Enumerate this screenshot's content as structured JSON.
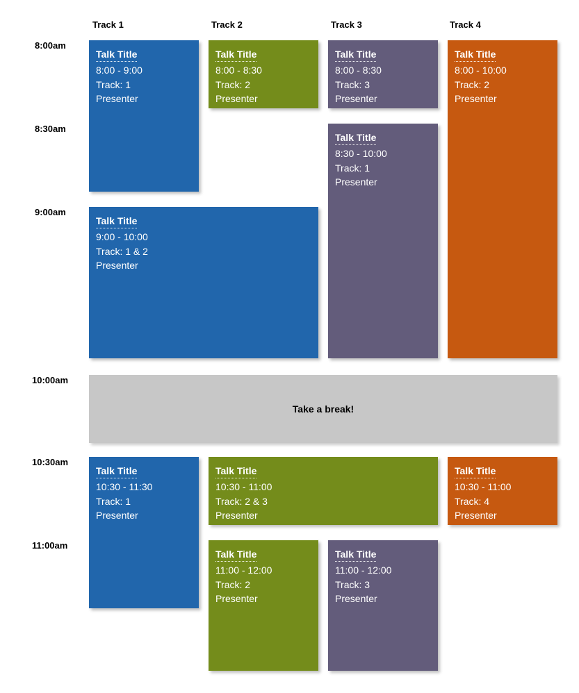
{
  "tracks": [
    {
      "label": "Track 1"
    },
    {
      "label": "Track 2"
    },
    {
      "label": "Track 3"
    },
    {
      "label": "Track 4"
    }
  ],
  "times": [
    {
      "label": "8:00am"
    },
    {
      "label": "8:30am"
    },
    {
      "label": "9:00am"
    },
    {
      "label": "10:00am"
    },
    {
      "label": "10:30am"
    },
    {
      "label": "11:00am"
    }
  ],
  "sessions": [
    {
      "title": "Talk Title",
      "time": "8:00 - 9:00",
      "track": "Track: 1",
      "presenter": "Presenter"
    },
    {
      "title": "Talk Title",
      "time": "8:00 - 8:30",
      "track": "Track: 2",
      "presenter": "Presenter"
    },
    {
      "title": "Talk Title",
      "time": "8:00 - 8:30",
      "track": "Track: 3",
      "presenter": "Presenter"
    },
    {
      "title": "Talk Title",
      "time": "8:00 - 10:00",
      "track": "Track: 2",
      "presenter": "Presenter"
    },
    {
      "title": "Talk Title",
      "time": "8:30 - 10:00",
      "track": "Track: 1",
      "presenter": "Presenter"
    },
    {
      "title": "Talk Title",
      "time": "9:00 - 10:00",
      "track": "Track: 1 & 2",
      "presenter": "Presenter"
    },
    {
      "title": "Talk Title",
      "time": "10:30 - 11:30",
      "track": "Track: 1",
      "presenter": "Presenter"
    },
    {
      "title": "Talk Title",
      "time": "10:30 - 11:00",
      "track": "Track: 2 & 3",
      "presenter": "Presenter"
    },
    {
      "title": "Talk Title",
      "time": "10:30 - 11:00",
      "track": "Track: 4",
      "presenter": "Presenter"
    },
    {
      "title": "Talk Title",
      "time": "11:00 - 12:00",
      "track": "Track: 2",
      "presenter": "Presenter"
    },
    {
      "title": "Talk Title",
      "time": "11:00 - 12:00",
      "track": "Track: 3",
      "presenter": "Presenter"
    }
  ],
  "break_text": "Take a break!"
}
